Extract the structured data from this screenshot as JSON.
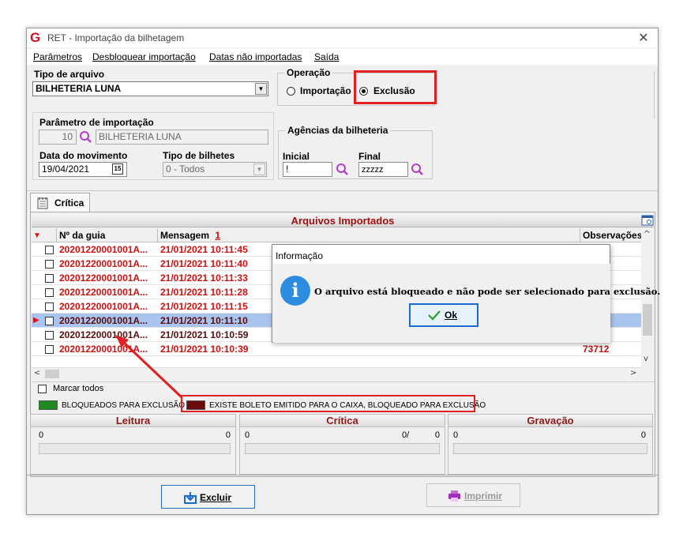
{
  "window": {
    "title": "RET - Importação da bilhetagem",
    "app_icon_glyph": "G",
    "close_glyph": "✕"
  },
  "menu": [
    "Parâmetros",
    "Desbloquear importação",
    "Datas não importadas",
    "Saída"
  ],
  "tipo_arquivo": {
    "label": "Tipo de arquivo",
    "value": "BILHETERIA LUNA"
  },
  "operacao": {
    "label": "Operação",
    "options": [
      "Importação",
      "Exclusão"
    ],
    "selected": "Exclusão"
  },
  "parametro": {
    "label": "Parâmetro de importação",
    "code": "10",
    "name": "BILHETERIA LUNA"
  },
  "data_movimento": {
    "label": "Data do movimento",
    "value": "19/04/2021",
    "calendar_glyph": "15"
  },
  "tipo_bilhetes": {
    "label": "Tipo de bilhetes",
    "value": "0 - Todos"
  },
  "agencias": {
    "label": "Agências da bilheteria",
    "inicial_label": "Inicial",
    "inicial_value": "!",
    "final_label": "Final",
    "final_value": "zzzzz"
  },
  "tab": {
    "label": "Crítica"
  },
  "grid": {
    "title": "Arquivos Importados",
    "columns": [
      "Nº da guia",
      "Mensagem",
      "Observações"
    ],
    "sort_indicator": "1",
    "rows": [
      {
        "guia": "20201220001001A...",
        "mensagem": "21/01/2021 10:11:45",
        "obs": "",
        "color": "red"
      },
      {
        "guia": "20201220001001A...",
        "mensagem": "21/01/2021 10:11:40",
        "obs": "",
        "color": "red"
      },
      {
        "guia": "20201220001001A...",
        "mensagem": "21/01/2021 10:11:33",
        "obs": "",
        "color": "red"
      },
      {
        "guia": "20201220001001A...",
        "mensagem": "21/01/2021 10:11:28",
        "obs": "",
        "color": "red"
      },
      {
        "guia": "20201220001001A...",
        "mensagem": "21/01/2021 10:11:15",
        "obs": "",
        "color": "red"
      },
      {
        "guia": "20201220001001A...",
        "mensagem": "21/01/2021 10:11:10",
        "obs": "",
        "color": "dark",
        "selected": true
      },
      {
        "guia": "20201220001001A...",
        "mensagem": "21/01/2021 10:10:59",
        "obs": "",
        "color": "dark"
      },
      {
        "guia": "20201220001001A...",
        "mensagem": "21/01/2021 10:10:39",
        "obs": "73712",
        "color": "red"
      }
    ]
  },
  "marcar_todos": "Marcar todos",
  "legend": [
    {
      "text": "BLOQUEADOS PARA EXCLUSÃO",
      "color": "#1f8a1f"
    },
    {
      "text": "EXISTE BOLETO EMITIDO PARA O CAIXA, BLOQUEADO PARA EXCLUSÃO",
      "color": "#6a0c0c"
    }
  ],
  "sections": [
    {
      "title": "Leitura",
      "left": "0",
      "right": "0"
    },
    {
      "title": "Crítica",
      "left": "0",
      "middle": "0/",
      "right": "0"
    },
    {
      "title": "Gravação",
      "left": "0",
      "right": "0"
    }
  ],
  "buttons": {
    "excluir": "Excluir",
    "imprimir": "Imprimir"
  },
  "dialog": {
    "title": "Informação",
    "icon_glyph": "i",
    "message": "O arquivo está bloqueado e não pode ser selecionado para exclusão.",
    "ok": "Ok"
  },
  "colors": {
    "highlight_red": "#e02020",
    "row_red": "#cc1010",
    "row_dark": "#5a0c0c",
    "selected_row": "#a9c4ef"
  }
}
